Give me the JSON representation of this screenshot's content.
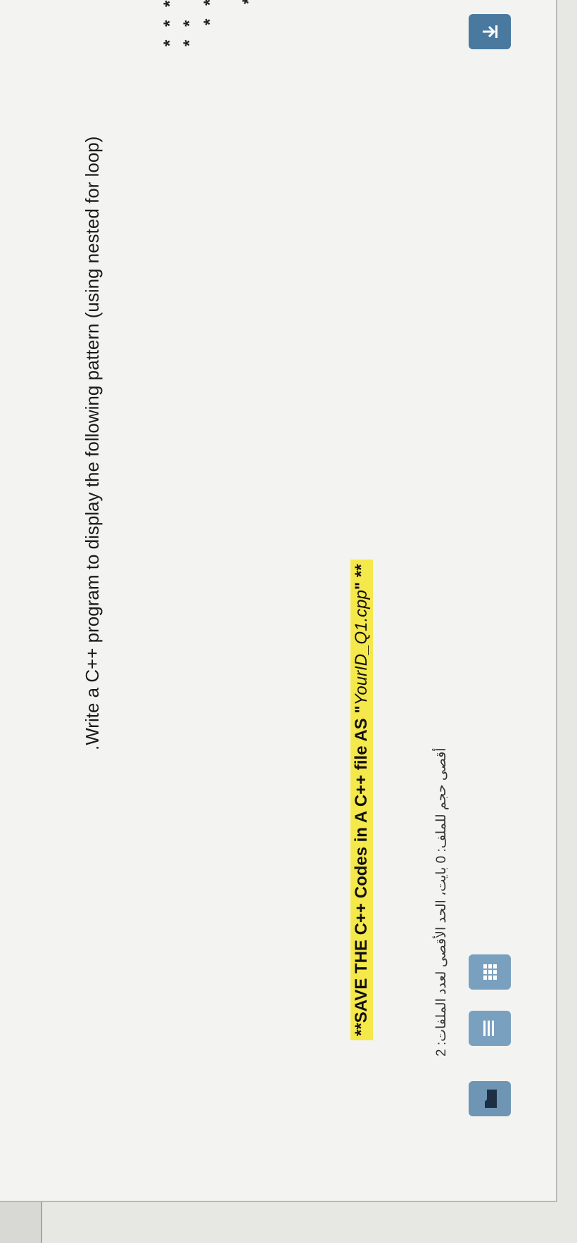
{
  "question": {
    "text": ".Write a C++ program to display the following pattern (using nested for loop)"
  },
  "pattern": {
    "rows": [
      "* * * * * *",
      "* * *",
      "*"
    ]
  },
  "note": {
    "prefix": "**SAVE THE C++ Codes in A C++ file AS \"",
    "filename": "YourID_Q1.cpp",
    "suffix": "\" **"
  },
  "upload": {
    "limits_text": "أقصى حجم للملف: 0 بايت، الحد الأقصى لعدد الملفات: 2"
  },
  "icons": {
    "folder": "folder-icon",
    "list": "list-view-icon",
    "grid": "grid-view-icon",
    "add": "add-file-icon",
    "file": "file-icon"
  },
  "colors": {
    "highlight": "#f5e84a",
    "button": "#4a79a0"
  }
}
